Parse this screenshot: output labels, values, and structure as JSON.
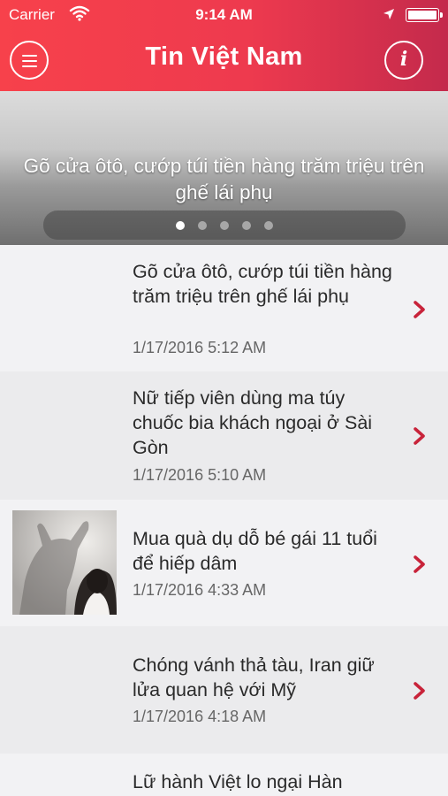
{
  "status_bar": {
    "carrier": "Carrier",
    "time": "9:14 AM"
  },
  "header": {
    "title": "Tin Việt Nam",
    "menu_icon": "hamburger-menu-icon",
    "info_icon": "info-icon",
    "info_glyph": "i"
  },
  "banner": {
    "title": "Gõ cửa ôtô, cướp túi tiền hàng trăm triệu trên ghế lái phụ",
    "page_count": 5,
    "active_page": 1
  },
  "articles": [
    {
      "title": "Gõ cửa ôtô, cướp túi tiền hàng trăm triệu trên ghế lái phụ",
      "date": "1/17/2016 5:12 AM",
      "has_thumbnail": false
    },
    {
      "title": "Nữ tiếp viên dùng ma túy chuốc bia khách ngoại ở Sài Gòn",
      "date": "1/17/2016 5:10 AM",
      "has_thumbnail": false
    },
    {
      "title": "Mua quà dụ dỗ bé gái 11 tuổi để hiếp dâm",
      "date": "1/17/2016 4:33 AM",
      "has_thumbnail": true
    },
    {
      "title": "Chóng vánh thả tàu, Iran giữ lửa quan hệ với Mỹ",
      "date": "1/17/2016 4:18 AM",
      "has_thumbnail": false
    },
    {
      "title": "Lữ hành Việt lo ngại Hàn",
      "date": "",
      "has_thumbnail": false
    }
  ],
  "colors": {
    "header_start": "#f7414b",
    "header_end": "#c42a4c",
    "chevron": "#c8233a"
  }
}
